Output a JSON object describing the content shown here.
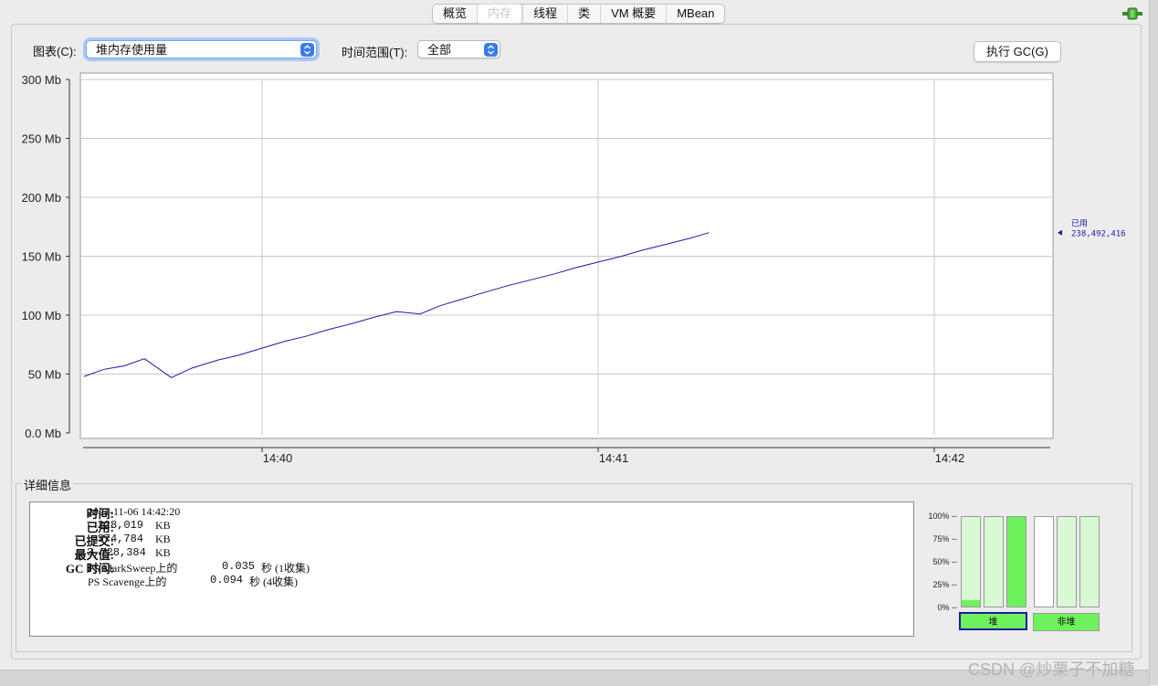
{
  "tabs": [
    {
      "label": "概览",
      "selected": false
    },
    {
      "label": "内存",
      "selected": true
    },
    {
      "label": "线程",
      "selected": false
    },
    {
      "label": "类",
      "selected": false
    },
    {
      "label": "VM 概要",
      "selected": false
    },
    {
      "label": "MBean",
      "selected": false
    }
  ],
  "toolbar": {
    "chart_label": "图表(C):",
    "chart_value": "堆内存使用量",
    "range_label": "时间范围(T):",
    "range_value": "全部",
    "gc_button": "执行 GC(G)"
  },
  "chart_data": {
    "type": "line",
    "y_tick_labels": [
      "0.0 Mb",
      "50 Mb",
      "100 Mb",
      "150 Mb",
      "200 Mb",
      "250 Mb",
      "300 Mb"
    ],
    "x_tick_labels": [
      "14:40",
      "14:41",
      "14:42"
    ],
    "ylim": [
      0,
      300
    ],
    "xlim_minutes": [
      -0.54,
      1.33
    ],
    "grid": true,
    "series": [
      {
        "name": "已用",
        "value_label": "238,492,416",
        "color": "#1a1aa8",
        "x": [
          -0.53,
          -0.47,
          -0.41,
          -0.35,
          -0.27,
          -0.21,
          -0.13,
          -0.07,
          0.0,
          0.07,
          0.13,
          0.2,
          0.27,
          0.33,
          0.4,
          0.47,
          0.53,
          0.6,
          0.67,
          0.73,
          0.8,
          0.87,
          0.93,
          1.0,
          1.07,
          1.13,
          1.2,
          1.27,
          1.33
        ],
        "y": [
          48,
          54,
          57,
          63,
          47,
          55,
          62,
          66,
          72,
          78,
          82,
          88,
          93,
          98,
          103,
          101,
          108,
          114,
          120,
          125,
          130,
          135,
          140,
          145,
          150,
          155,
          160,
          165,
          170
        ]
      }
    ]
  },
  "details": {
    "title": "详细信息",
    "time_label": "时间:",
    "time_value": "2021-11-06 14:42:20",
    "used_label": "已用:",
    "used_value": "228,019",
    "committed_label": "已提交:",
    "committed_value": "374,784",
    "max_label": "最大值:",
    "max_value": "3,728,384",
    "unit": "KB",
    "gc_label": "GC 时间:",
    "gc_rows": [
      {
        "name": "PS MarkSweep上的",
        "value": "0.035",
        "unit": "秒",
        "note": "(1收集)"
      },
      {
        "name": "PS Scavenge上的",
        "value": "0.094",
        "unit": "秒",
        "note": "(4收集)"
      }
    ]
  },
  "pools": {
    "pct_labels": [
      "100% --",
      "75% --",
      "50% --",
      "25% --",
      "0% --"
    ],
    "heap_label": "堆",
    "nonheap_label": "非堆",
    "heap_bars": [
      0.07,
      0.0,
      1.0
    ],
    "heap_bar_committed": [
      1.0,
      1.0,
      1.0
    ],
    "nonheap_bars": [
      0.0,
      0.0,
      0.0
    ],
    "nonheap_bar_committed": [
      0.0,
      1.0,
      1.0
    ],
    "fill_color": "#6ef25c"
  },
  "watermark": "CSDN @炒栗子不加糖"
}
